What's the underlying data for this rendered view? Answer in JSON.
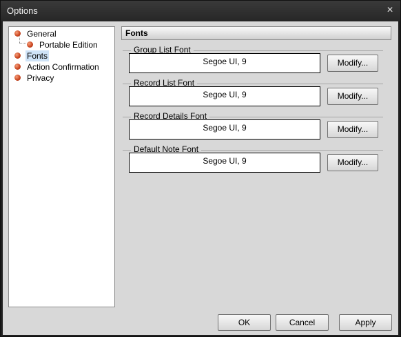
{
  "window": {
    "title": "Options",
    "close_glyph": "×"
  },
  "tree": {
    "items": [
      {
        "label": "General",
        "level": 0,
        "selected": false
      },
      {
        "label": "Portable Edition",
        "level": 1,
        "selected": false
      },
      {
        "label": "Fonts",
        "level": 0,
        "selected": true
      },
      {
        "label": "Action Confirmation",
        "level": 0,
        "selected": false
      },
      {
        "label": "Privacy",
        "level": 0,
        "selected": false
      }
    ]
  },
  "section": {
    "title": "Fonts"
  },
  "font_groups": [
    {
      "label": "Group List Font",
      "value": "Segoe UI, 9",
      "button": "Modify..."
    },
    {
      "label": "Record List Font",
      "value": "Segoe UI, 9",
      "button": "Modify..."
    },
    {
      "label": "Record Details Font",
      "value": "Segoe UI, 9",
      "button": "Modify..."
    },
    {
      "label": "Default Note Font",
      "value": "Segoe UI, 9",
      "button": "Modify..."
    }
  ],
  "buttons": {
    "ok": "OK",
    "cancel": "Cancel",
    "apply": "Apply"
  },
  "colors": {
    "bullet": "#c8421c",
    "selection": "#cfe3f7",
    "titlebar": "#2a2a2a"
  }
}
